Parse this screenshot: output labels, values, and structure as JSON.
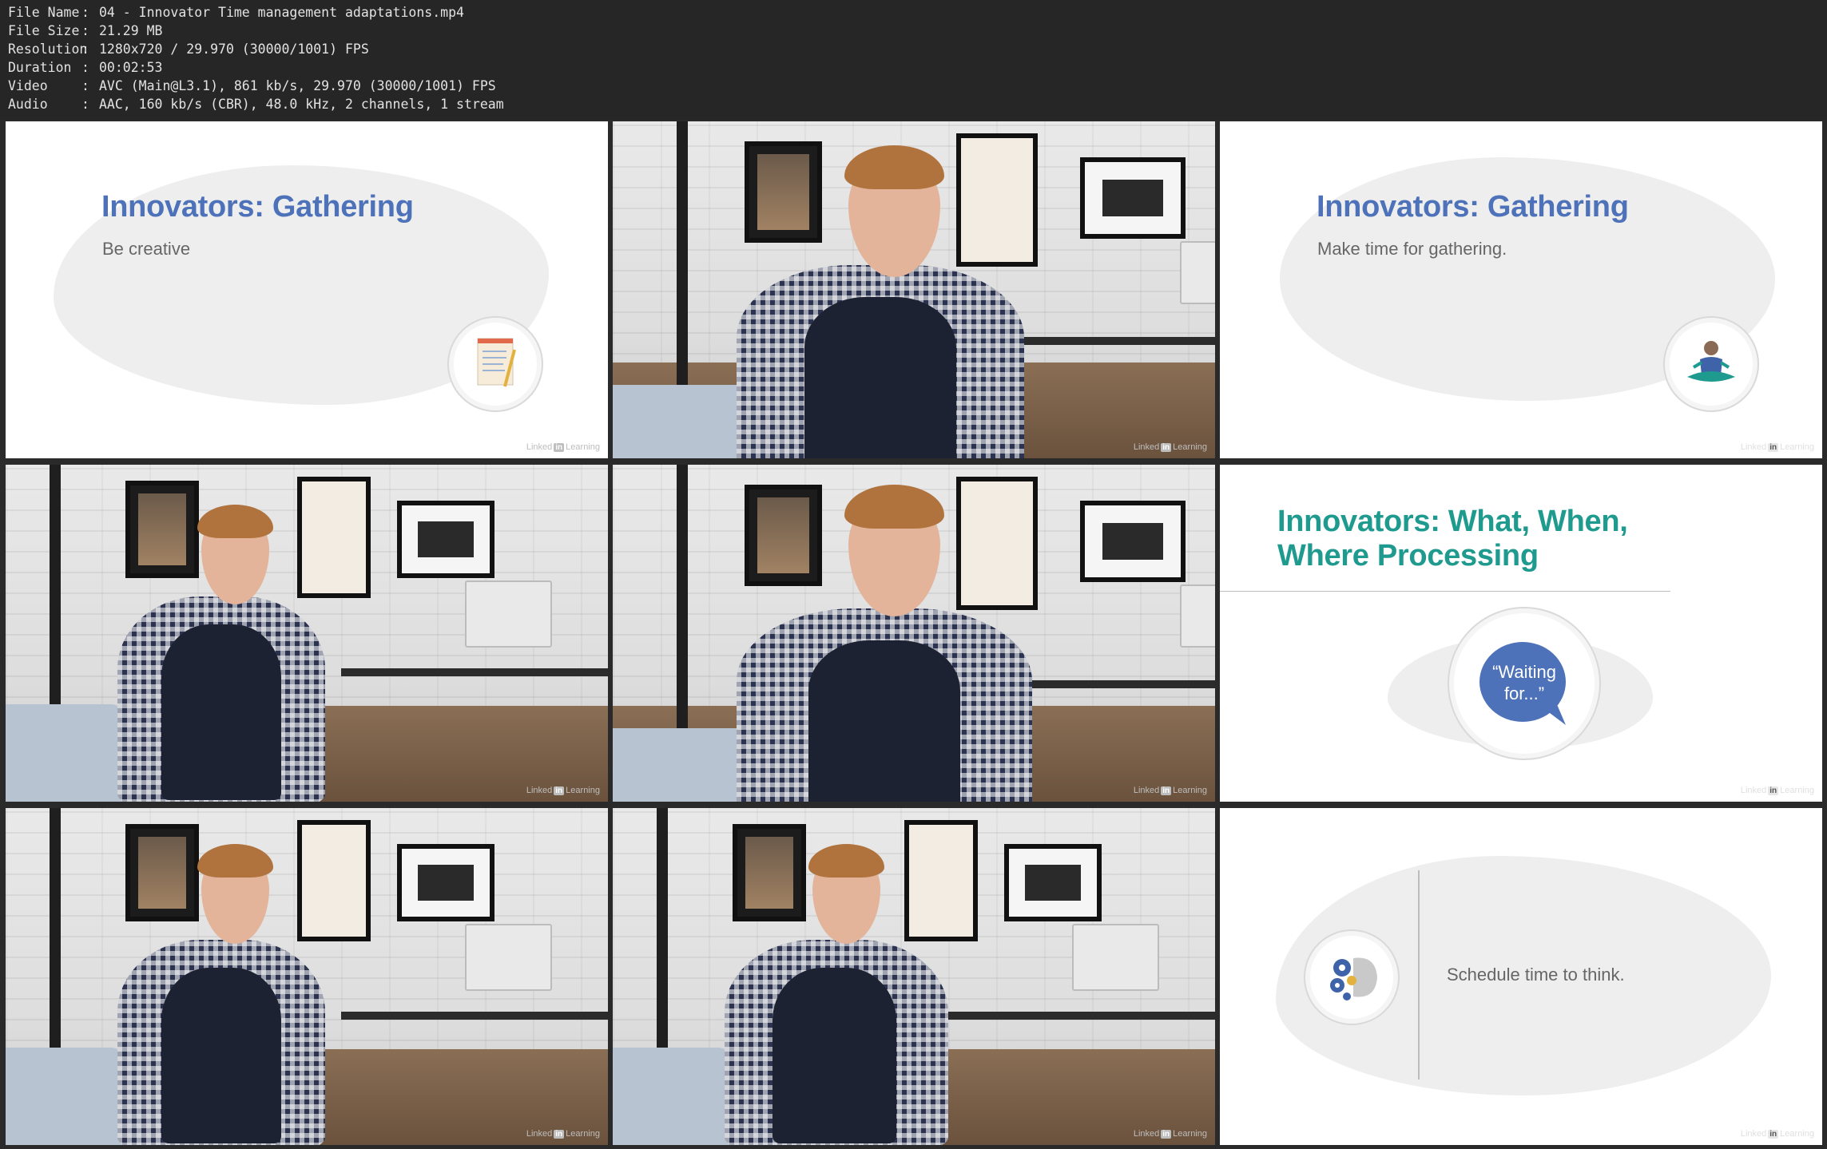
{
  "file_info": [
    {
      "key": "File Name",
      "value": "04 - Innovator Time management adaptations.mp4"
    },
    {
      "key": "File Size",
      "value": "21.29 MB"
    },
    {
      "key": "Resolution",
      "value": "1280x720 / 29.970 (30000/1001) FPS"
    },
    {
      "key": "Duration",
      "value": "00:02:53"
    },
    {
      "key": "Video",
      "value": "AVC (Main@L3.1), 861 kb/s, 29.970 (30000/1001) FPS"
    },
    {
      "key": "Audio",
      "value": "AAC, 160 kb/s (CBR), 48.0 kHz, 2 channels, 1 stream"
    }
  ],
  "separator": ":",
  "watermark": {
    "pre": "Linked",
    "in": "in",
    "post": "Learning"
  },
  "tiles": {
    "t1": {
      "title": "Innovators: Gathering",
      "subtitle": "Be creative",
      "icon": "notepad-icon"
    },
    "t3": {
      "title": "Innovators: Gathering",
      "subtitle": "Make time for gathering.",
      "icon": "meditation-icon"
    },
    "t6": {
      "title_line1": "Innovators: What, When,",
      "title_line2": "Where Processing",
      "bubble_line1": "“Waiting",
      "bubble_line2": "for...”",
      "icon": "speech-bubble-icon"
    },
    "t9": {
      "subtitle": "Schedule time to think.",
      "icon": "gears-brain-icon"
    }
  },
  "colors": {
    "title_blue": "#4e72b9",
    "title_teal": "#1f9a8e",
    "bubble_blue": "#4e72b9",
    "background": "#262626"
  }
}
